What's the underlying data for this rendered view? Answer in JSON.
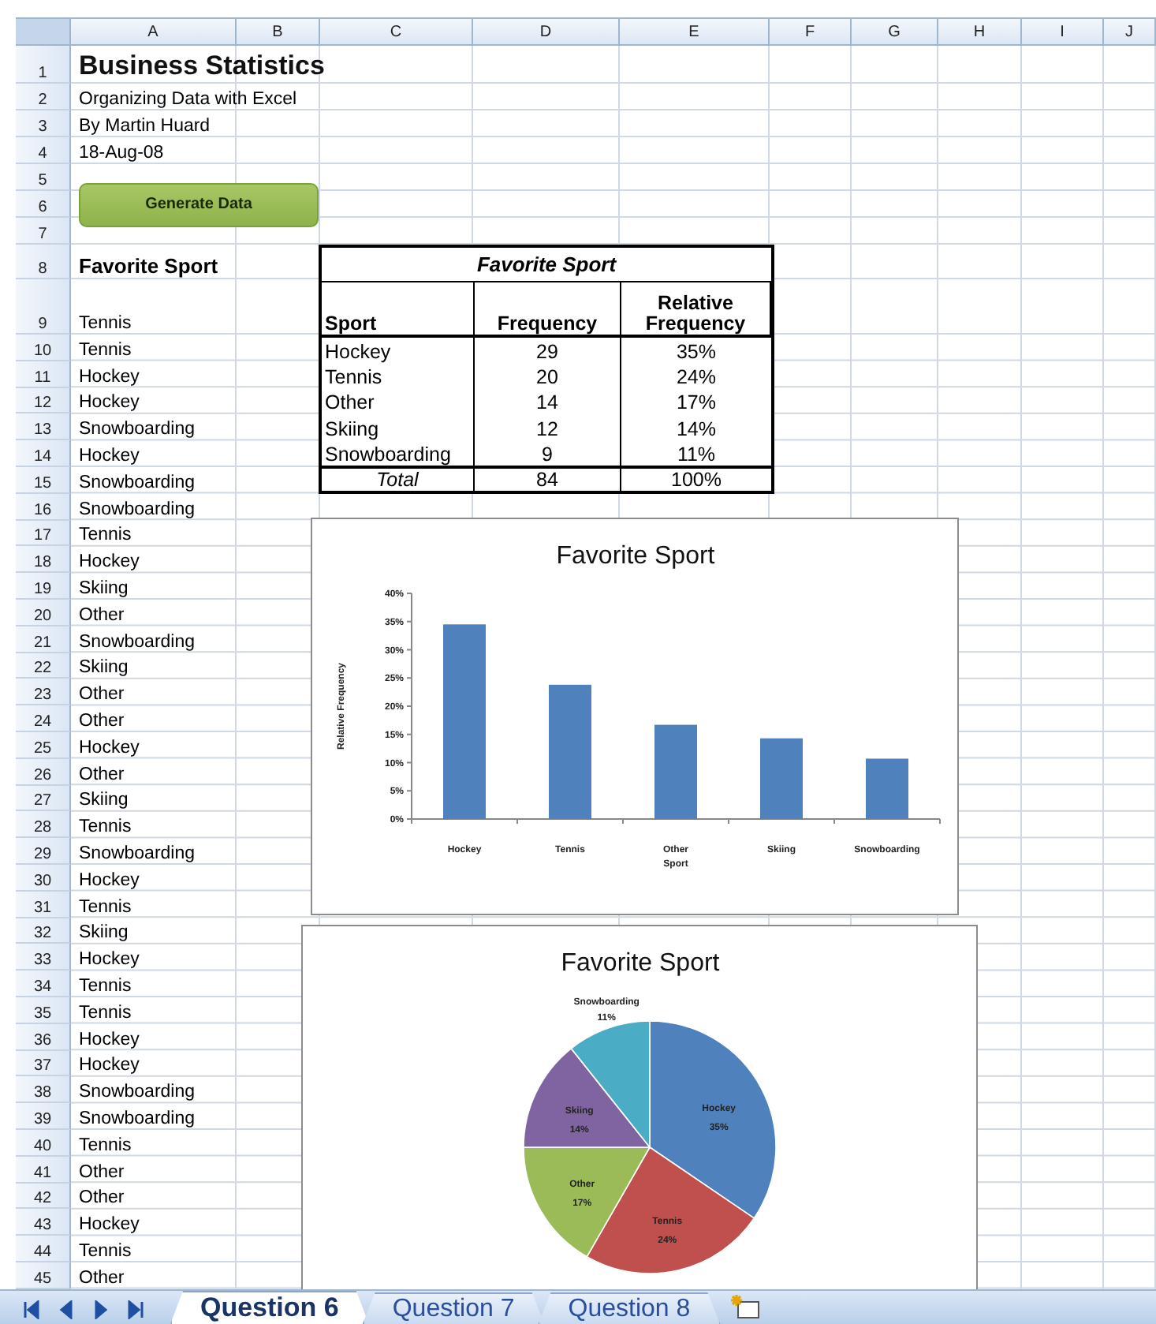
{
  "column_headers": [
    "A",
    "B",
    "C",
    "D",
    "E",
    "F",
    "G",
    "H",
    "I",
    "J"
  ],
  "row_numbers": [
    "1",
    "2",
    "3",
    "4",
    "5",
    "6",
    "7",
    "8",
    "9",
    "10",
    "11",
    "12",
    "13",
    "14",
    "15",
    "16",
    "17",
    "18",
    "19",
    "20",
    "21",
    "22",
    "23",
    "24",
    "25",
    "26",
    "27",
    "28",
    "29",
    "30",
    "31",
    "32",
    "33",
    "34",
    "35",
    "36",
    "37",
    "38",
    "39",
    "40",
    "41",
    "42",
    "43",
    "44",
    "45"
  ],
  "header": {
    "title": "Business Statistics",
    "subtitle": "Organizing Data with Excel",
    "author": "By Martin Huard",
    "date": "18-Aug-08"
  },
  "button": {
    "label": "Generate Data"
  },
  "data_column": {
    "heading": "Favorite Sport",
    "values": [
      "Tennis",
      "Tennis",
      "Hockey",
      "Hockey",
      "Snowboarding",
      "Hockey",
      "Snowboarding",
      "Snowboarding",
      "Tennis",
      "Hockey",
      "Skiing",
      "Other",
      "Snowboarding",
      "Skiing",
      "Other",
      "Other",
      "Hockey",
      "Other",
      "Skiing",
      "Tennis",
      "Snowboarding",
      "Hockey",
      "Tennis",
      "Skiing",
      "Hockey",
      "Tennis",
      "Tennis",
      "Hockey",
      "Hockey",
      "Snowboarding",
      "Snowboarding",
      "Tennis",
      "Other",
      "Other",
      "Hockey",
      "Tennis",
      "Other"
    ]
  },
  "summary_table": {
    "title": "Favorite Sport",
    "columns": [
      "Sport",
      "Frequency",
      "Relative Frequency"
    ],
    "rows": [
      [
        "Hockey",
        "29",
        "35%"
      ],
      [
        "Tennis",
        "20",
        "24%"
      ],
      [
        "Other",
        "14",
        "17%"
      ],
      [
        "Skiing",
        "12",
        "14%"
      ],
      [
        "Snowboarding",
        "9",
        "11%"
      ]
    ],
    "total": [
      "Total",
      "84",
      "100%"
    ]
  },
  "bar_chart": {
    "chart_data": {
      "type": "bar",
      "title": "Favorite Sport",
      "xlabel": "Sport",
      "ylabel": "Relative Frequency",
      "categories": [
        "Hockey",
        "Tennis",
        "Other",
        "Skiing",
        "Snowboarding"
      ],
      "values": [
        0.345,
        0.238,
        0.167,
        0.143,
        0.107
      ],
      "ylim": [
        0,
        0.4
      ],
      "yticks": [
        {
          "value": 0,
          "label": "0%"
        },
        {
          "value": 0.05,
          "label": "5%"
        },
        {
          "value": 0.1,
          "label": "10%"
        },
        {
          "value": 0.15,
          "label": "15%"
        },
        {
          "value": 0.2,
          "label": "20%"
        },
        {
          "value": 0.25,
          "label": "25%"
        },
        {
          "value": 0.3,
          "label": "30%"
        },
        {
          "value": 0.35,
          "label": "35%"
        },
        {
          "value": 0.4,
          "label": "40%"
        }
      ]
    }
  },
  "pie_chart": {
    "chart_data": {
      "type": "pie",
      "title": "Favorite Sport",
      "categories": [
        "Hockey",
        "Tennis",
        "Other",
        "Skiing",
        "Snowboarding"
      ],
      "values": [
        0.345,
        0.238,
        0.167,
        0.143,
        0.107
      ],
      "value_labels": [
        "35%",
        "24%",
        "17%",
        "14%",
        "11%"
      ]
    }
  },
  "sheet_tabs": [
    {
      "label": "Question 6",
      "selected": true
    },
    {
      "label": "Question 7",
      "selected": false
    },
    {
      "label": "Question 8",
      "selected": false
    }
  ]
}
